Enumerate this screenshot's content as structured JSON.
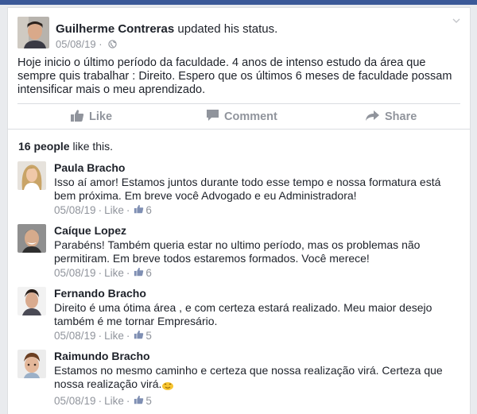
{
  "post": {
    "author": "Guilherme Contreras",
    "action": " updated his status.",
    "date": "05/08/19",
    "text": "Hoje inicio o último período da faculdade. 4 anos de intenso estudo da área que sempre quis trabalhar : Direito. Espero que os últimos 6 meses de faculdade possam intensificar mais o meu aprendizado."
  },
  "actions": {
    "like": "Like",
    "comment": "Comment",
    "share": "Share"
  },
  "likes": {
    "count": "16 people",
    "suffix": " like this."
  },
  "comments": [
    {
      "name": "Paula Bracho",
      "text": "Isso aí amor! Estamos juntos durante todo esse tempo e nossa formatura está bem próxima. Em breve você Advogado e eu Administradora!",
      "date": "05/08/19",
      "like_label": "Like",
      "reactions": "6"
    },
    {
      "name": "Caíque Lopez",
      "text": "Parabéns! Também queria estar no ultimo período, mas os problemas não permitiram. Em breve todos  estaremos formados. Você merece!",
      "date": "05/08/19",
      "like_label": "Like",
      "reactions": "6"
    },
    {
      "name": "Fernando Bracho",
      "text": "Direito é uma ótima área , e com certeza estará realizado. Meu maior desejo também é me tornar Empresário.",
      "date": "05/08/19",
      "like_label": "Like",
      "reactions": "5"
    },
    {
      "name": "Raimundo Bracho",
      "text": "Estamos no mesmo caminho e certeza que nossa realização virá. Certeza que nossa realização virá.",
      "date": "05/08/19",
      "like_label": "Like",
      "reactions": "5"
    }
  ],
  "colors": {
    "brand": "#3b5998",
    "muted": "#90949c",
    "text": "#1d2129",
    "like_blue": "#4267b2"
  }
}
